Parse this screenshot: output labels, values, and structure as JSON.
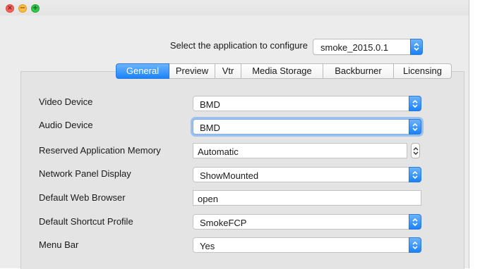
{
  "window": {
    "traffic_lights": [
      "close",
      "minimize",
      "zoom"
    ]
  },
  "app_selector": {
    "label": "Select the application to configure",
    "value": "smoke_2015.0.1"
  },
  "tabs": [
    {
      "label": "General",
      "active": true
    },
    {
      "label": "Preview",
      "active": false
    },
    {
      "label": "Vtr",
      "active": false
    },
    {
      "label": "Media Storage",
      "active": false
    },
    {
      "label": "Backburner",
      "active": false
    },
    {
      "label": "Licensing",
      "active": false
    }
  ],
  "settings": {
    "video_device": {
      "label": "Video Device",
      "value": "BMD"
    },
    "audio_device": {
      "label": "Audio Device",
      "value": "BMD"
    },
    "reserved_memory": {
      "label": "Reserved Application Memory",
      "value": "Automatic"
    },
    "network_panel": {
      "label": "Network Panel Display",
      "value": "ShowMounted"
    },
    "web_browser": {
      "label": "Default Web Browser",
      "value": "open"
    },
    "shortcut_profile": {
      "label": "Default Shortcut Profile",
      "value": "SmokeFCP"
    },
    "menu_bar": {
      "label": "Menu Bar",
      "value": "Yes"
    }
  },
  "colors": {
    "accent": "#1b83fb",
    "close": "#fc605b",
    "minimize": "#fdbc40",
    "zoom": "#34c84a"
  },
  "icons": {
    "close": "×",
    "minimize": "−",
    "zoom": "+"
  }
}
